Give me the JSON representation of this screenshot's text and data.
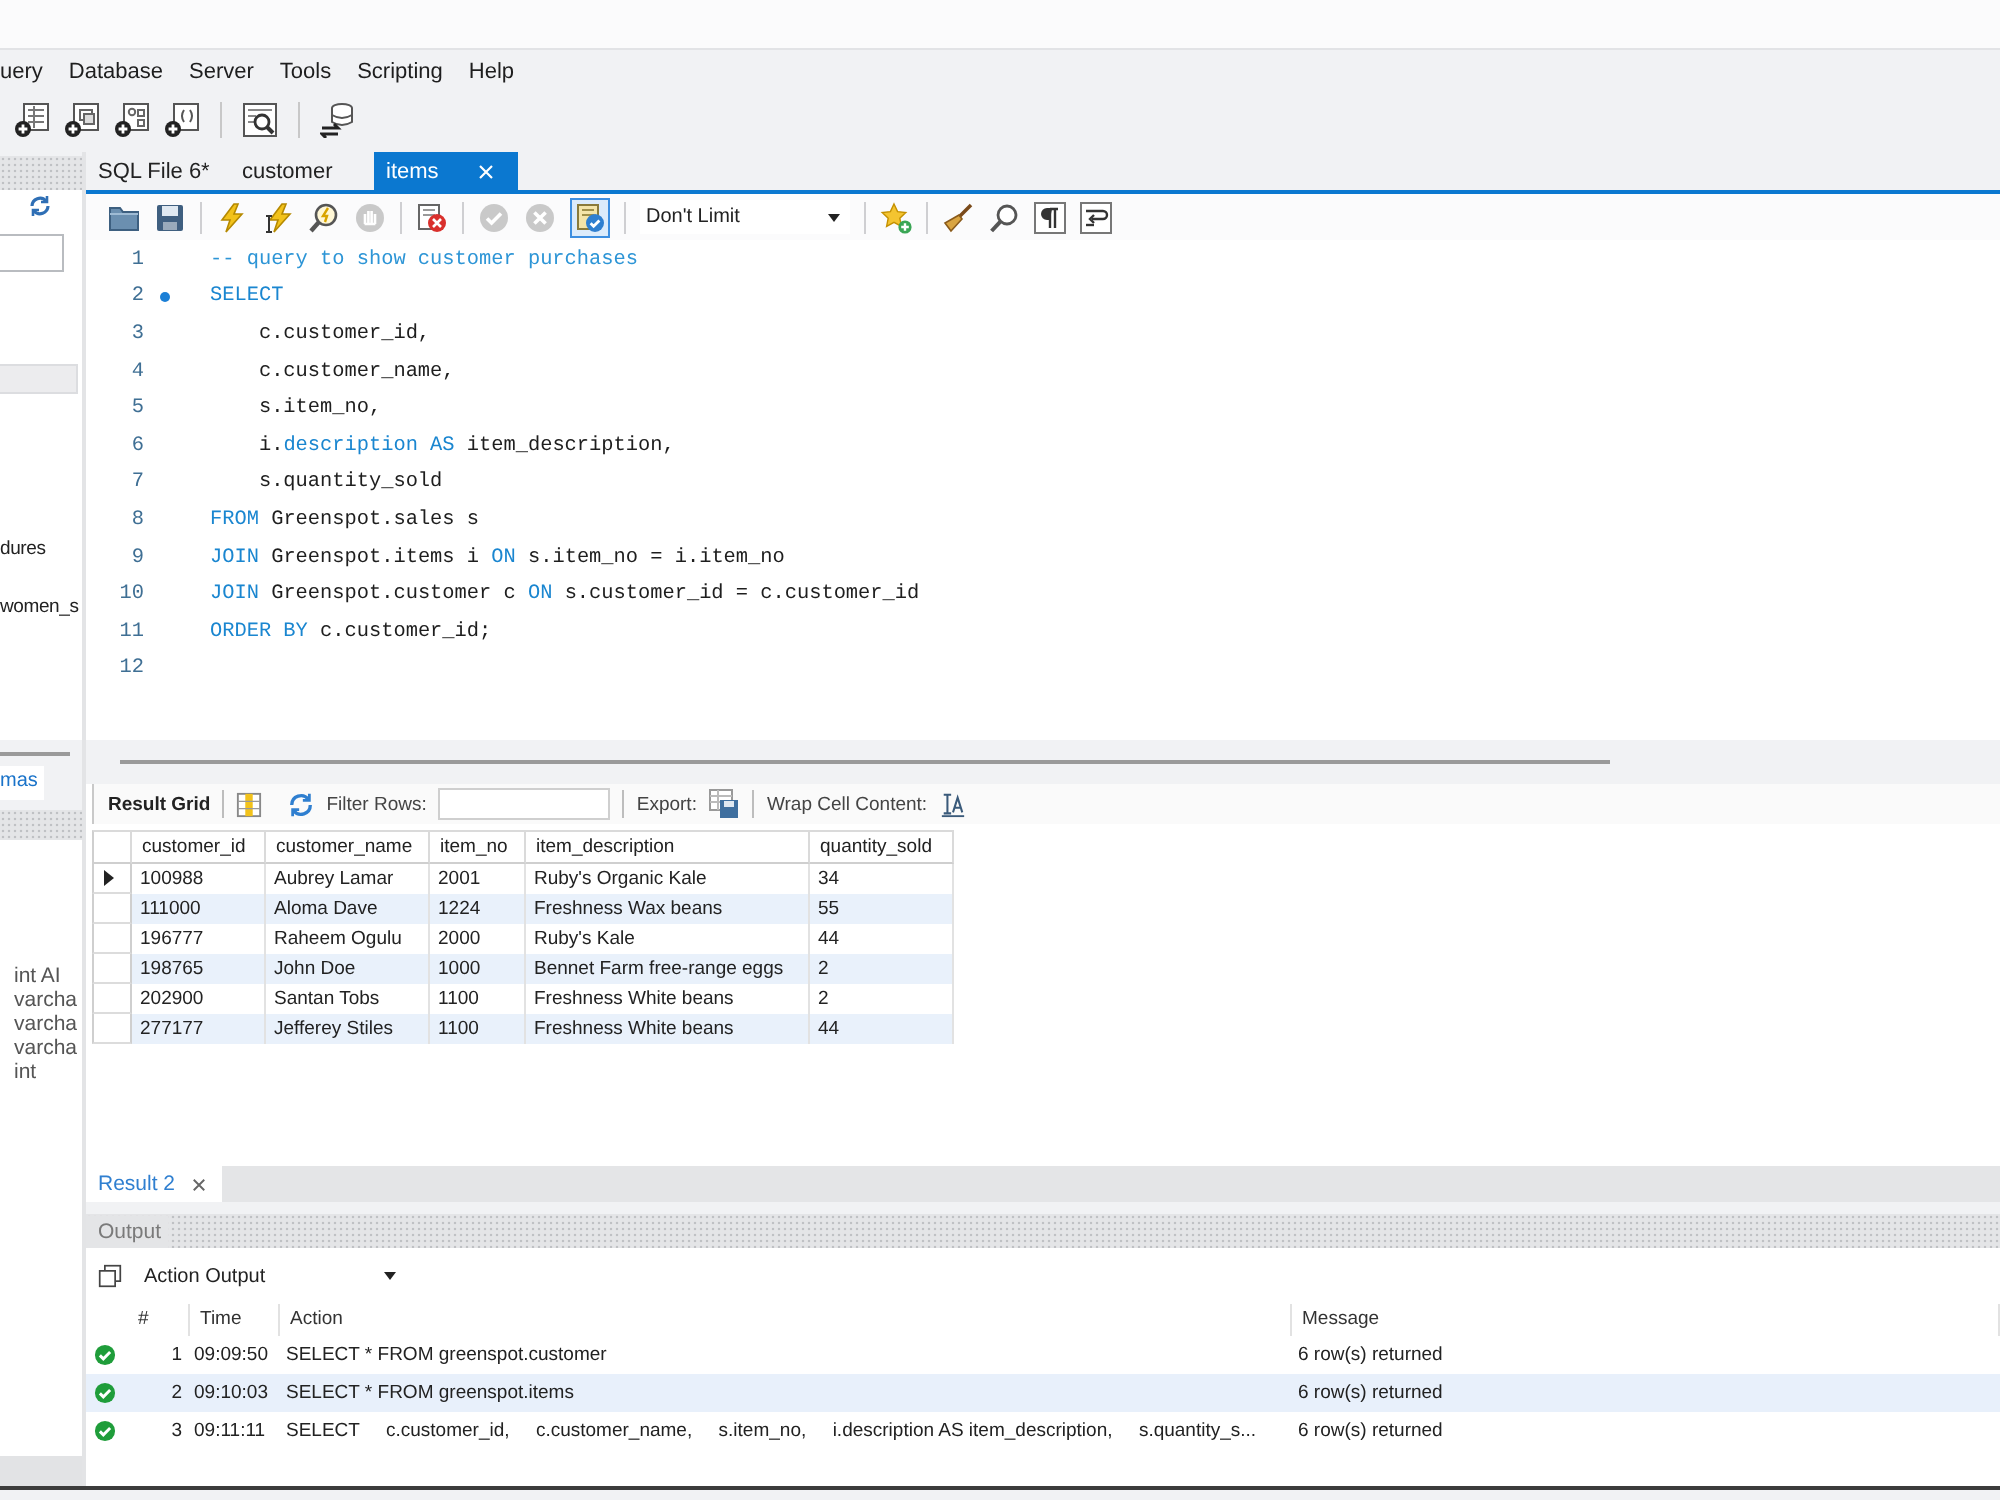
{
  "menu_bar": [
    "uery",
    "Database",
    "Server",
    "Tools",
    "Scripting",
    "Help"
  ],
  "sidebar": {
    "navigator_items": [
      "dures",
      "women_s"
    ],
    "tabs": [
      {
        "label": "mas",
        "selected": true
      }
    ],
    "info_lines": [
      "int AI",
      "varcha",
      "varcha",
      "varcha",
      "int"
    ]
  },
  "editor_tabs": [
    {
      "label": "SQL File 6*",
      "selected": false
    },
    {
      "label": "customer",
      "selected": false
    },
    {
      "label": "items",
      "selected": true
    }
  ],
  "editor_toolbar": {
    "hand_disabled": true,
    "check_disabled": true,
    "cross_disabled": true,
    "toggle_pressed": true,
    "row_limit": "Don't Limit"
  },
  "editor": {
    "lines": [
      {
        "number": "1",
        "marker": false,
        "tokens": [
          {
            "kind": "comment",
            "text": "-- query to show customer purchases"
          }
        ]
      },
      {
        "number": "2",
        "marker": true,
        "tokens": [
          {
            "kind": "keyword",
            "text": "SELECT"
          }
        ]
      },
      {
        "number": "3",
        "marker": false,
        "tokens": [
          {
            "kind": "plain",
            "text": "    c.customer_id,"
          }
        ]
      },
      {
        "number": "4",
        "marker": false,
        "tokens": [
          {
            "kind": "plain",
            "text": "    c.customer_name,"
          }
        ]
      },
      {
        "number": "5",
        "marker": false,
        "tokens": [
          {
            "kind": "plain",
            "text": "    s.item_no,"
          }
        ]
      },
      {
        "number": "6",
        "marker": false,
        "tokens": [
          {
            "kind": "plain",
            "text": "    i."
          },
          {
            "kind": "keyword",
            "text": "description AS"
          },
          {
            "kind": "plain",
            "text": " item_description,"
          }
        ]
      },
      {
        "number": "7",
        "marker": false,
        "tokens": [
          {
            "kind": "plain",
            "text": "    s.quantity_sold"
          }
        ]
      },
      {
        "number": "8",
        "marker": false,
        "tokens": [
          {
            "kind": "keyword",
            "text": "FROM"
          },
          {
            "kind": "plain",
            "text": " Greenspot.sales s"
          }
        ]
      },
      {
        "number": "9",
        "marker": false,
        "tokens": [
          {
            "kind": "keyword",
            "text": "JOIN"
          },
          {
            "kind": "plain",
            "text": " Greenspot.items i "
          },
          {
            "kind": "keyword",
            "text": "ON"
          },
          {
            "kind": "plain",
            "text": " s.item_no = i.item_no"
          }
        ]
      },
      {
        "number": "10",
        "marker": false,
        "tokens": [
          {
            "kind": "keyword",
            "text": "JOIN"
          },
          {
            "kind": "plain",
            "text": " Greenspot.customer c "
          },
          {
            "kind": "keyword",
            "text": "ON"
          },
          {
            "kind": "plain",
            "text": " s.customer_id = c.customer_id"
          }
        ]
      },
      {
        "number": "11",
        "marker": false,
        "tokens": [
          {
            "kind": "keyword",
            "text": "ORDER BY"
          },
          {
            "kind": "plain",
            "text": " c.customer_id;"
          }
        ]
      },
      {
        "number": "12",
        "marker": false
      }
    ]
  },
  "result_toolbar": {
    "title": "Result Grid",
    "filter_label": "Filter Rows:",
    "export_label": "Export:",
    "wrap_label": "Wrap Cell Content:"
  },
  "result_grid": {
    "columns": [
      "customer_id",
      "customer_name",
      "item_no",
      "item_description",
      "quantity_sold"
    ],
    "rows": [
      {
        "current": true,
        "cells": [
          "100988",
          "Aubrey Lamar",
          "2001",
          "Ruby's Organic Kale",
          "34"
        ]
      },
      {
        "current": false,
        "cells": [
          "111000",
          "Aloma Dave",
          "1224",
          "Freshness Wax beans",
          "55"
        ]
      },
      {
        "current": false,
        "cells": [
          "196777",
          "Raheem Ogulu",
          "2000",
          "Ruby's Kale",
          "44"
        ]
      },
      {
        "current": false,
        "cells": [
          "198765",
          "John Doe",
          "1000",
          "Bennet Farm free-range eggs",
          "2"
        ]
      },
      {
        "current": false,
        "cells": [
          "202900",
          "Santan Tobs",
          "1100",
          "Freshness White beans",
          "2"
        ]
      },
      {
        "current": false,
        "cells": [
          "277177",
          "Jefferey Stiles",
          "1100",
          "Freshness White beans",
          "44"
        ]
      }
    ]
  },
  "result_tabs": [
    {
      "label": "Result 2",
      "selected": true
    }
  ],
  "output": {
    "title": "Output",
    "view": "Action Output",
    "columns": [
      "#",
      "Time",
      "Action",
      "Message"
    ],
    "rows": [
      {
        "kind": "success",
        "selected": false,
        "number": "1",
        "time": "09:09:50",
        "action": "SELECT * FROM greenspot.customer",
        "message": "6 row(s) returned"
      },
      {
        "kind": "success",
        "selected": true,
        "number": "2",
        "time": "09:10:03",
        "action": "SELECT * FROM greenspot.items",
        "message": "6 row(s) returned"
      },
      {
        "kind": "success",
        "selected": false,
        "number": "3",
        "time": "09:11:11",
        "action": "SELECT     c.customer_id,     c.customer_name,     s.item_no,     i.description AS item_description,     s.quantity_s...",
        "message": "6 row(s) returned"
      }
    ]
  }
}
